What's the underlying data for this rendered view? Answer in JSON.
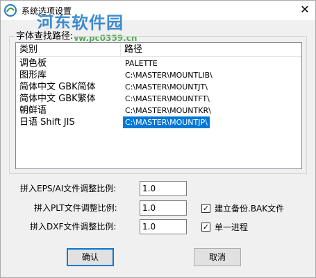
{
  "window": {
    "title": "系统选项设置",
    "close_glyph": "✕"
  },
  "watermark": {
    "text": "河东软件园",
    "url": "www.pc0359.cn"
  },
  "font_paths": {
    "group_label": "字体查找路径:",
    "columns": [
      "类别",
      "路径"
    ],
    "rows": [
      {
        "type": "调色板",
        "path": "PALETTE",
        "selected": false
      },
      {
        "type": "图形库",
        "path": "C:\\MASTER\\MOUNTLIB\\",
        "selected": false
      },
      {
        "type": "简体中文 GBK简体",
        "path": "C:\\MASTER\\MOUNTJT\\",
        "selected": false
      },
      {
        "type": "简体中文 GBK繁体",
        "path": "C:\\MASTER\\MOUNTFT\\",
        "selected": false
      },
      {
        "type": "朝鲜语",
        "path": "C:\\MASTER\\MOUNTKR\\",
        "selected": false
      },
      {
        "type": "日语 Shift JIS",
        "path": "C:\\MASTER\\MOUNTJP\\",
        "selected": true
      }
    ]
  },
  "scales": {
    "eps_label": "拼入EPS/AI文件调整比例:",
    "eps_value": "1.0",
    "plt_label": "拼入PLT文件调整比例:",
    "plt_value": "1.0",
    "dxf_label": "拼入DXF文件调整比例:",
    "dxf_value": "1.0"
  },
  "options": {
    "backup_label": "建立备份.BAK文件",
    "backup_checked": true,
    "single_process_label": "单一进程",
    "single_process_checked": true,
    "check_glyph": "✓"
  },
  "buttons": {
    "ok": "确认",
    "cancel": "取消"
  },
  "colors": {
    "selection": "#0078d7",
    "watermark": "#1f78c8"
  }
}
